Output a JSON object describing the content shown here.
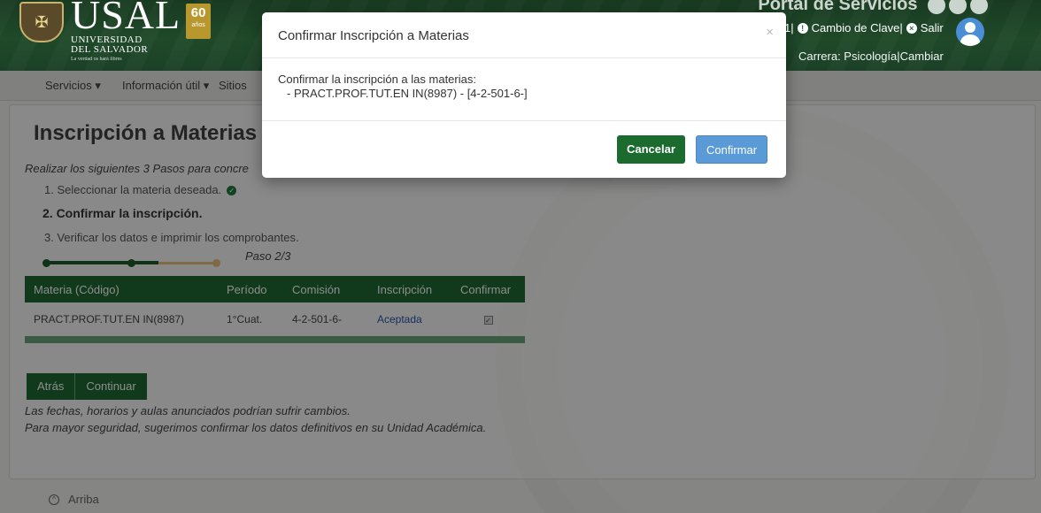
{
  "header": {
    "logo_main": "USAL",
    "logo_sub1": "Universidad",
    "logo_sub2": "del Salvador",
    "logo_tagline": "La verdad os hará libres",
    "anniv_number": "60",
    "anniv_label": "años",
    "portal_title": "Portal de Servicios",
    "user_suffix": "1|",
    "change_password": "Cambio de Clave|",
    "logout": "Salir",
    "career": "Carrera: Psicología|Cambiar"
  },
  "nav": {
    "services": "Servicios ▾",
    "info": "Información útil ▾",
    "sites": "Sitios"
  },
  "main": {
    "title": "Inscripción a Materias",
    "intro": "Realizar los siguientes 3 Pasos para concre",
    "step1": "1. Seleccionar la materia deseada.",
    "step2": "2. Confirmar la inscripción.",
    "step3": "3. Verificar los datos e imprimir los comprobantes.",
    "progress_label": "Paso 2/3",
    "progress_value": 0.66,
    "table": {
      "headers": [
        "Materia (Código)",
        "Período",
        "Comisión",
        "Inscripción",
        "Confirmar"
      ],
      "rows": [
        {
          "materia": "PRACT.PROF.TUT.EN IN(8987)",
          "periodo": "1°Cuat.",
          "comision": "4-2-501-6-",
          "inscripcion": "Aceptada",
          "confirmar": true
        }
      ]
    },
    "back_button": "Atrás",
    "continue_button": "Continuar",
    "note1": "Las fechas, horarios y aulas anunciados podrían sufrir cambios.",
    "note2": "Para mayor seguridad, sugerimos confirmar los datos definitivos en su Unidad Académica.",
    "top_link": "Arriba"
  },
  "modal": {
    "title": "Confirmar Inscripción a Materias",
    "close": "×",
    "body_line": "Confirmar la inscripción a las materias:",
    "item": "-  PRACT.PROF.TUT.EN IN(8987) - [4-2-501-6-]",
    "cancel": "Cancelar",
    "confirm": "Confirmar"
  },
  "colors": {
    "brand_green": "#1f6a33",
    "confirm_blue": "#5a9ad6",
    "progress_pending": "#e2c37a"
  }
}
